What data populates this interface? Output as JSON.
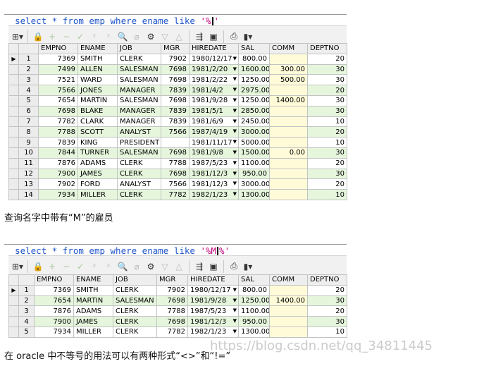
{
  "query1": {
    "kw1": "select * from emp where ename like ",
    "str": "'%",
    "cursor_after": "",
    "str_end": "'"
  },
  "query2": {
    "kw1": "select * from emp where ename like ",
    "str": "'%M",
    "str_end": "%'"
  },
  "columns": [
    "EMPNO",
    "ENAME",
    "JOB",
    "MGR",
    "HIREDATE",
    "SAL",
    "COMM",
    "DEPTNO"
  ],
  "table1": [
    {
      "n": "1",
      "empno": "7369",
      "ename": "SMITH",
      "job": "CLERK",
      "mgr": "7902",
      "hiredate": "1980/12/17",
      "sal": "800.00",
      "comm": "",
      "deptno": "20"
    },
    {
      "n": "2",
      "empno": "7499",
      "ename": "ALLEN",
      "job": "SALESMAN",
      "mgr": "7698",
      "hiredate": "1981/2/20",
      "sal": "1600.00",
      "comm": "300.00",
      "deptno": "30"
    },
    {
      "n": "3",
      "empno": "7521",
      "ename": "WARD",
      "job": "SALESMAN",
      "mgr": "7698",
      "hiredate": "1981/2/22",
      "sal": "1250.00",
      "comm": "500.00",
      "deptno": "30"
    },
    {
      "n": "4",
      "empno": "7566",
      "ename": "JONES",
      "job": "MANAGER",
      "mgr": "7839",
      "hiredate": "1981/4/2",
      "sal": "2975.00",
      "comm": "",
      "deptno": "20"
    },
    {
      "n": "5",
      "empno": "7654",
      "ename": "MARTIN",
      "job": "SALESMAN",
      "mgr": "7698",
      "hiredate": "1981/9/28",
      "sal": "1250.00",
      "comm": "1400.00",
      "deptno": "30"
    },
    {
      "n": "6",
      "empno": "7698",
      "ename": "BLAKE",
      "job": "MANAGER",
      "mgr": "7839",
      "hiredate": "1981/5/1",
      "sal": "2850.00",
      "comm": "",
      "deptno": "30"
    },
    {
      "n": "7",
      "empno": "7782",
      "ename": "CLARK",
      "job": "MANAGER",
      "mgr": "7839",
      "hiredate": "1981/6/9",
      "sal": "2450.00",
      "comm": "",
      "deptno": "10"
    },
    {
      "n": "8",
      "empno": "7788",
      "ename": "SCOTT",
      "job": "ANALYST",
      "mgr": "7566",
      "hiredate": "1987/4/19",
      "sal": "3000.00",
      "comm": "",
      "deptno": "20"
    },
    {
      "n": "9",
      "empno": "7839",
      "ename": "KING",
      "job": "PRESIDENT",
      "mgr": "",
      "hiredate": "1981/11/17",
      "sal": "5000.00",
      "comm": "",
      "deptno": "10"
    },
    {
      "n": "10",
      "empno": "7844",
      "ename": "TURNER",
      "job": "SALESMAN",
      "mgr": "7698",
      "hiredate": "1981/9/8",
      "sal": "1500.00",
      "comm": "0.00",
      "deptno": "30"
    },
    {
      "n": "11",
      "empno": "7876",
      "ename": "ADAMS",
      "job": "CLERK",
      "mgr": "7788",
      "hiredate": "1987/5/23",
      "sal": "1100.00",
      "comm": "",
      "deptno": "20"
    },
    {
      "n": "12",
      "empno": "7900",
      "ename": "JAMES",
      "job": "CLERK",
      "mgr": "7698",
      "hiredate": "1981/12/3",
      "sal": "950.00",
      "comm": "",
      "deptno": "30"
    },
    {
      "n": "13",
      "empno": "7902",
      "ename": "FORD",
      "job": "ANALYST",
      "mgr": "7566",
      "hiredate": "1981/12/3",
      "sal": "3000.00",
      "comm": "",
      "deptno": "20"
    },
    {
      "n": "14",
      "empno": "7934",
      "ename": "MILLER",
      "job": "CLERK",
      "mgr": "7782",
      "hiredate": "1982/1/23",
      "sal": "1300.00",
      "comm": "",
      "deptno": "10"
    }
  ],
  "table2": [
    {
      "n": "1",
      "empno": "7369",
      "ename": "SMITH",
      "job": "CLERK",
      "mgr": "7902",
      "hiredate": "1980/12/17",
      "sal": "800.00",
      "comm": "",
      "deptno": "20"
    },
    {
      "n": "2",
      "empno": "7654",
      "ename": "MARTIN",
      "job": "SALESMAN",
      "mgr": "7698",
      "hiredate": "1981/9/28",
      "sal": "1250.00",
      "comm": "1400.00",
      "deptno": "30"
    },
    {
      "n": "3",
      "empno": "7876",
      "ename": "ADAMS",
      "job": "CLERK",
      "mgr": "7788",
      "hiredate": "1987/5/23",
      "sal": "1100.00",
      "comm": "",
      "deptno": "20"
    },
    {
      "n": "4",
      "empno": "7900",
      "ename": "JAMES",
      "job": "CLERK",
      "mgr": "7698",
      "hiredate": "1981/12/3",
      "sal": "950.00",
      "comm": "",
      "deptno": "30"
    },
    {
      "n": "5",
      "empno": "7934",
      "ename": "MILLER",
      "job": "CLERK",
      "mgr": "7782",
      "hiredate": "1982/1/23",
      "sal": "1300.00",
      "comm": "",
      "deptno": "10"
    }
  ],
  "caption1": "查询名字中带有“M”的雇员",
  "caption2": "在 oracle 中不等号的用法可以有两种形式“<>”和“!=”",
  "watermark": "https://blog.csdn.net/qq_34811445",
  "colors": {
    "keyword": "#1f55c8",
    "string": "#c0007a",
    "row_alt": "#e5f6dc",
    "comm_bg": "#fffbd8"
  }
}
